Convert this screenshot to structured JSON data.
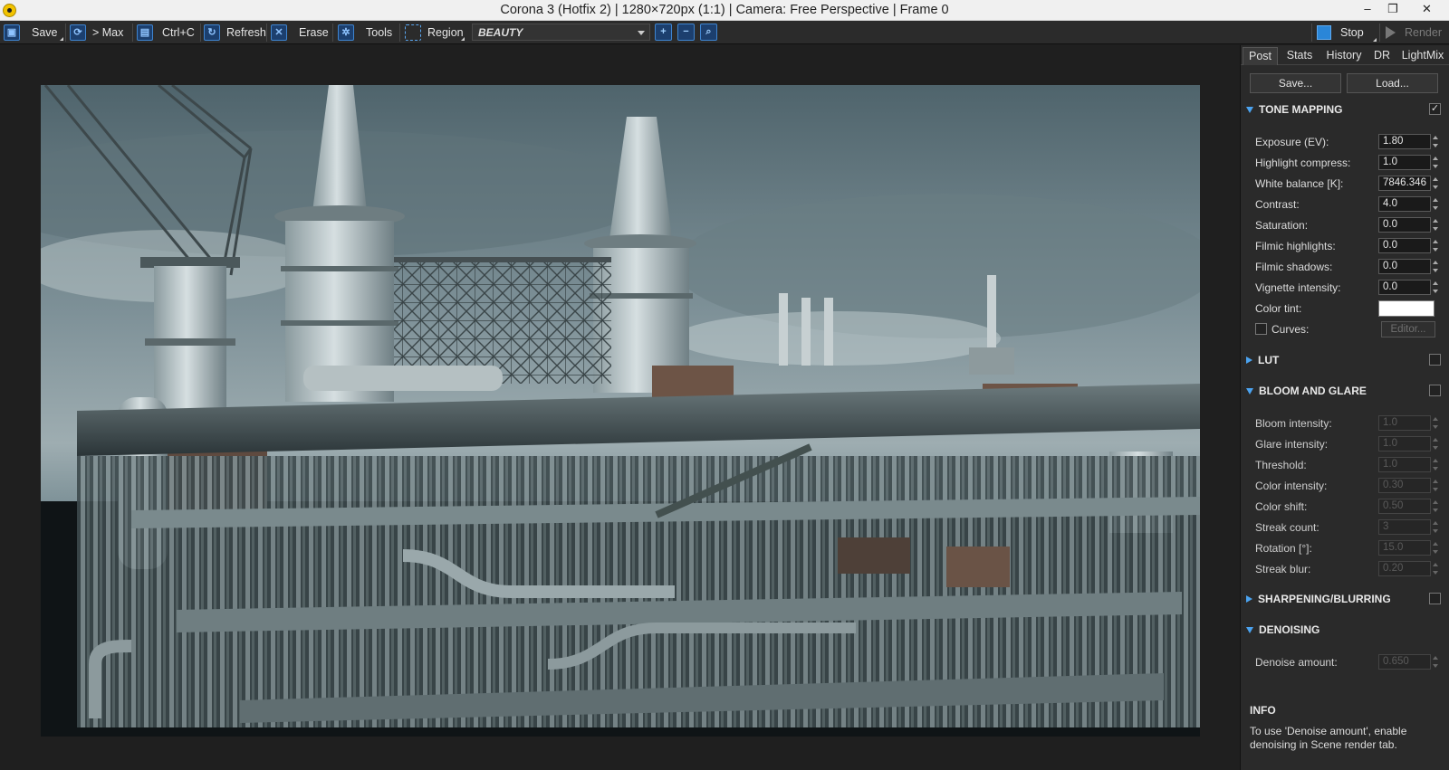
{
  "window": {
    "title": "Corona 3 (Hotfix 2) | 1280×720px (1:1) | Camera: Free Perspective | Frame 0",
    "minimize_glyph": "–",
    "restore_glyph": "❐",
    "close_glyph": "✕"
  },
  "toolbar": {
    "save_label": "Save",
    "max_label": "> Max",
    "copy_label": "Ctrl+C",
    "refresh_label": "Refresh",
    "erase_label": "Erase",
    "tools_label": "Tools",
    "region_label": "Region",
    "channel_value": "BEAUTY",
    "stop_label": "Stop",
    "render_label": "Render",
    "accent_color": "#2a86d8"
  },
  "panel": {
    "tabs": [
      {
        "label": "Post",
        "active": true
      },
      {
        "label": "Stats"
      },
      {
        "label": "History"
      },
      {
        "label": "DR"
      },
      {
        "label": "LightMix"
      }
    ],
    "save_button": "Save...",
    "load_button": "Load...",
    "tone_mapping": {
      "title": "TONE MAPPING",
      "enabled_glyph": "✓",
      "fields": [
        {
          "label": "Exposure (EV):",
          "value": "1.80"
        },
        {
          "label": "Highlight compress:",
          "value": "1.0"
        },
        {
          "label": "White balance [K]:",
          "value": "7846.346"
        },
        {
          "label": "Contrast:",
          "value": "4.0"
        },
        {
          "label": "Saturation:",
          "value": "0.0"
        },
        {
          "label": "Filmic highlights:",
          "value": "0.0"
        },
        {
          "label": "Filmic shadows:",
          "value": "0.0"
        },
        {
          "label": "Vignette intensity:",
          "value": "0.0"
        }
      ],
      "color_tint_label": "Color tint:",
      "color_tint_value": "#ffffff",
      "curves_label": "Curves:",
      "editor_label": "Editor..."
    },
    "lut": {
      "title": "LUT"
    },
    "bloom": {
      "title": "BLOOM AND GLARE",
      "fields": [
        {
          "label": "Bloom intensity:",
          "value": "1.0"
        },
        {
          "label": "Glare intensity:",
          "value": "1.0"
        },
        {
          "label": "Threshold:",
          "value": "1.0"
        },
        {
          "label": "Color intensity:",
          "value": "0.30"
        },
        {
          "label": "Color shift:",
          "value": "0.50"
        },
        {
          "label": "Streak count:",
          "value": "3"
        },
        {
          "label": "Rotation [°]:",
          "value": "15.0"
        },
        {
          "label": "Streak blur:",
          "value": "0.20"
        }
      ]
    },
    "sharpening": {
      "title": "SHARPENING/BLURRING"
    },
    "denoising": {
      "title": "DENOISING",
      "fields": [
        {
          "label": "Denoise amount:",
          "value": "0.650"
        }
      ]
    },
    "info": {
      "title": "INFO",
      "text": "To use 'Denoise amount', enable denoising in Scene render tab."
    }
  }
}
